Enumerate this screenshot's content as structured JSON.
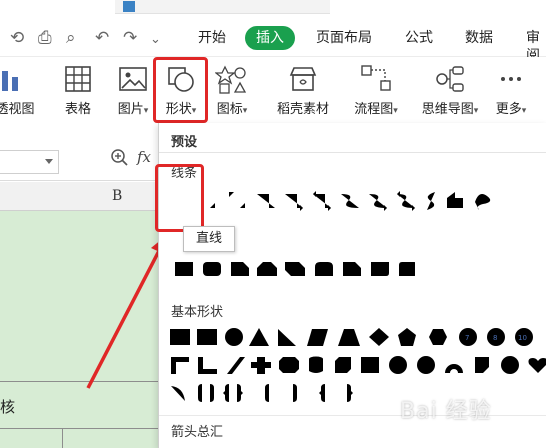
{
  "colors": {
    "accent": "#1aa04e",
    "highlight": "#e02727",
    "shape_stroke": "#4a6fb4",
    "sheet_fill": "#d7ecd4"
  },
  "menu": {
    "items": [
      "开始",
      "插入",
      "页面布局",
      "公式",
      "数据",
      "审阅"
    ],
    "active": "插入"
  },
  "ribbon": {
    "items": [
      "透视图",
      "表格",
      "图片",
      "形状",
      "图标",
      "稻壳素材",
      "流程图",
      "思维导图",
      "更多"
    ]
  },
  "formula_bar": {
    "fx": "fx"
  },
  "sheet": {
    "column_b": "B",
    "cell_text": "核"
  },
  "dropdown": {
    "preset_label": "预设",
    "lines_label": "线条",
    "tooltip": "直线",
    "basic_shapes_label": "基本形状",
    "arrows_label": "箭头总汇"
  },
  "watermark": "Bai 经验"
}
